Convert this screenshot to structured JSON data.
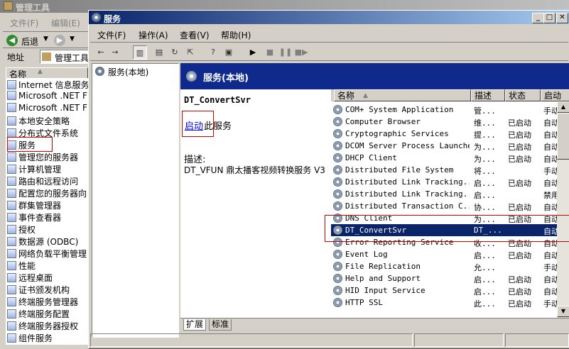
{
  "bg_window": {
    "title": "管理工具",
    "menu": [
      "文件(F)",
      "编辑(E)"
    ],
    "back_label": "后退",
    "address_label": "地址",
    "address_value": "管理工具",
    "list_header": "名称",
    "items": [
      "Internet 信息服务",
      "Microsoft .NET F",
      "Microsoft .NET F",
      "本地安全策略",
      "分布式文件系统",
      "服务",
      "管理您的服务器",
      "计算机管理",
      "路由和远程访问",
      "配置您的服务器向",
      "群集管理器",
      "事件查看器",
      "授权",
      "数据源 (ODBC)",
      "网络负载平衡管理",
      "性能",
      "远程桌面",
      "证书颁发机构",
      "终端服务管理器",
      "终端服务配置",
      "终端服务器授权",
      "组件服务"
    ]
  },
  "svc_window": {
    "title": "服务",
    "menu": [
      "文件(F)",
      "操作(A)",
      "查看(V)",
      "帮助(H)"
    ],
    "tree_root": "服务(本地)",
    "header_title": "服务(本地)",
    "detail": {
      "service_name": "DT_ConvertSvr",
      "start_link": "启动",
      "start_suffix": "此服务",
      "desc_label": "描述:",
      "desc_text": "DT_VFUN 鼎太播客视频转换服务 V3"
    },
    "columns": [
      "名称",
      "描述",
      "状态",
      "启动"
    ],
    "rows": [
      {
        "name": "COM+ System Application",
        "desc": "管...",
        "status": "",
        "startup": "手动"
      },
      {
        "name": "Computer Browser",
        "desc": "维...",
        "status": "已启动",
        "startup": "自动"
      },
      {
        "name": "Cryptographic Services",
        "desc": "提...",
        "status": "已启动",
        "startup": "自动"
      },
      {
        "name": "DCOM Server Process Launcher",
        "desc": "为...",
        "status": "已启动",
        "startup": "自动"
      },
      {
        "name": "DHCP Client",
        "desc": "为...",
        "status": "已启动",
        "startup": "自动"
      },
      {
        "name": "Distributed File System",
        "desc": "将...",
        "status": "",
        "startup": "手动"
      },
      {
        "name": "Distributed Link Tracking...",
        "desc": "启...",
        "status": "已启动",
        "startup": "自动"
      },
      {
        "name": "Distributed Link Tracking...",
        "desc": "启...",
        "status": "",
        "startup": "禁用"
      },
      {
        "name": "Distributed Transaction C...",
        "desc": "协...",
        "status": "已启动",
        "startup": "自动"
      },
      {
        "name": "DNS Client",
        "desc": "为...",
        "status": "已启动",
        "startup": "自动"
      },
      {
        "name": "DT_ConvertSvr",
        "desc": "DT_...",
        "status": "",
        "startup": "自动"
      },
      {
        "name": "Error Reporting Service",
        "desc": "收...",
        "status": "已启动",
        "startup": "自动"
      },
      {
        "name": "Event Log",
        "desc": "启...",
        "status": "已启动",
        "startup": "自动"
      },
      {
        "name": "File Replication",
        "desc": "允...",
        "status": "",
        "startup": "手动"
      },
      {
        "name": "Help and Support",
        "desc": "启...",
        "status": "已启动",
        "startup": "自动"
      },
      {
        "name": "HID Input Service",
        "desc": "启...",
        "status": "已启动",
        "startup": "自动"
      },
      {
        "name": "HTTP SSL",
        "desc": "此...",
        "status": "已启动",
        "startup": "手动"
      }
    ],
    "tabs": [
      "扩展",
      "标准"
    ]
  }
}
